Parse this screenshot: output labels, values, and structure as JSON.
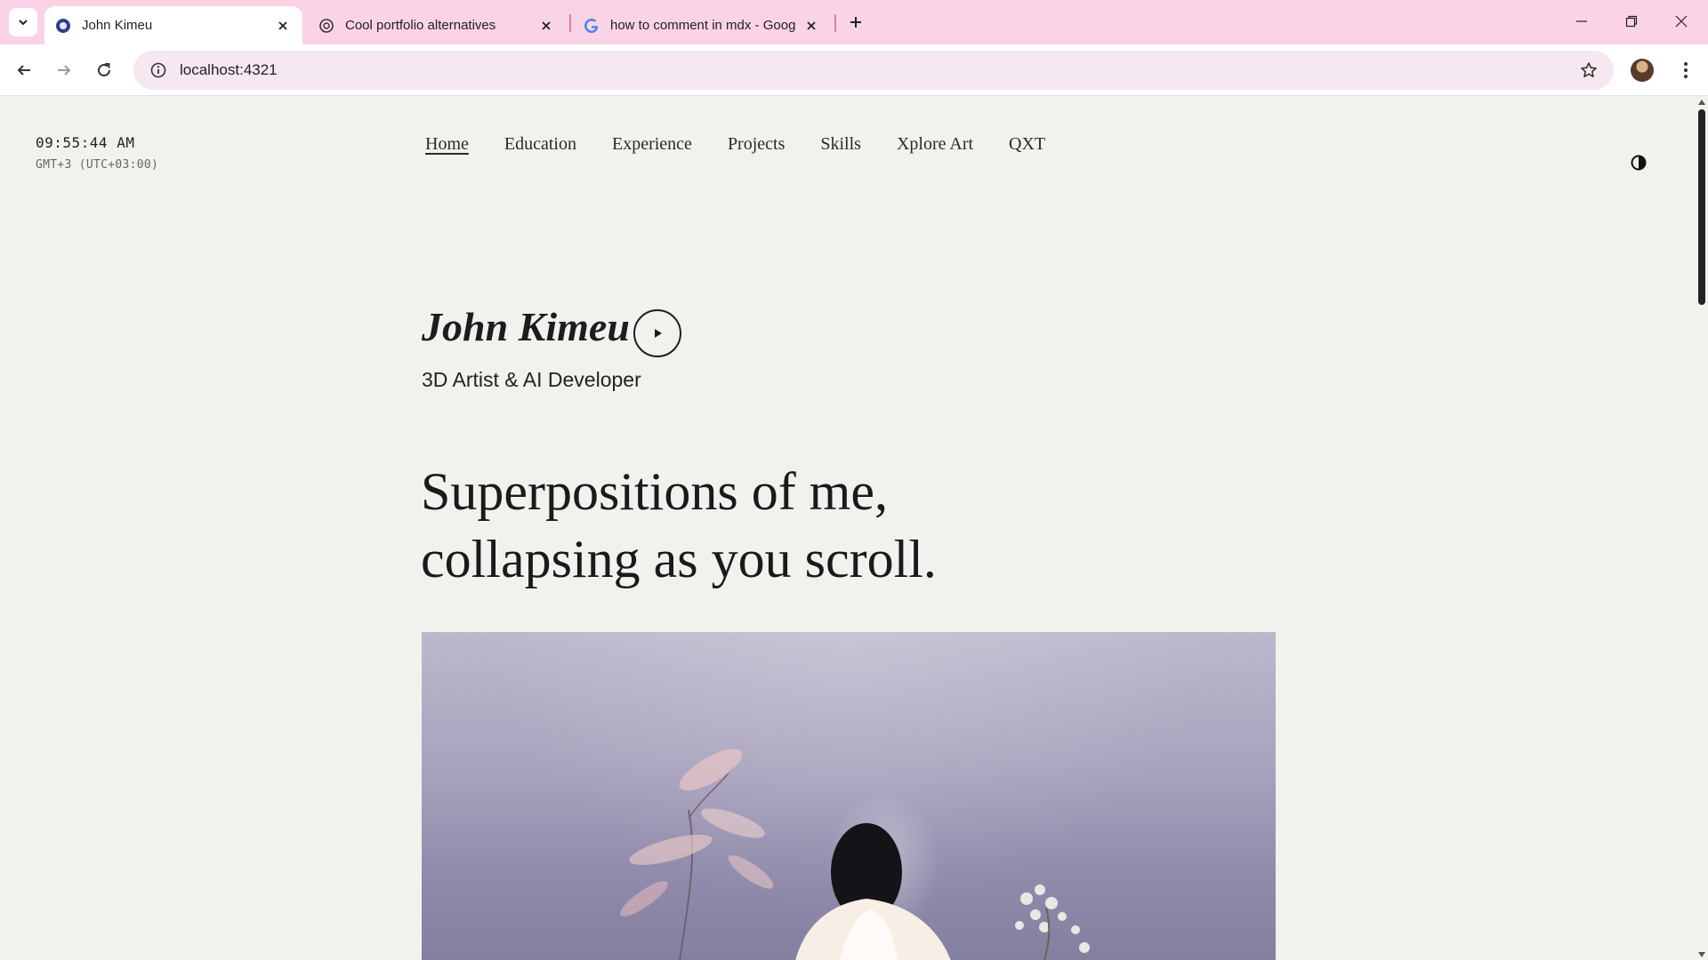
{
  "browser": {
    "tabs": [
      {
        "label": "John Kimeu",
        "active": true
      },
      {
        "label": "Cool portfolio alternatives",
        "active": false
      },
      {
        "label": "how to comment in mdx - Goog",
        "active": false
      }
    ],
    "url": "localhost:4321",
    "icons": {
      "tab_search": "chevron-down-icon",
      "new_tab": "plus-icon",
      "back": "arrow-left-icon",
      "forward": "arrow-right-icon",
      "reload": "reload-icon",
      "info": "info-icon",
      "bookmark": "star-icon",
      "menu": "kebab-icon"
    }
  },
  "page": {
    "clock": {
      "time": "09:55:44 AM",
      "timezone": "GMT+3 (UTC+03:00)"
    },
    "nav": [
      {
        "label": "Home",
        "active": true
      },
      {
        "label": "Education",
        "active": false
      },
      {
        "label": "Experience",
        "active": false
      },
      {
        "label": "Projects",
        "active": false
      },
      {
        "label": "Skills",
        "active": false
      },
      {
        "label": "Xplore Art",
        "active": false
      },
      {
        "label": "QXT",
        "active": false
      }
    ],
    "hero": {
      "name": "John Kimeu",
      "role": "3D Artist & AI Developer",
      "headline_line1": "Superpositions of me,",
      "headline_line2": "collapsing as you scroll."
    },
    "colors": {
      "tabbar": "#fbd3e6",
      "page_bg": "#f3f1ee",
      "text": "#1d1d1d"
    }
  }
}
